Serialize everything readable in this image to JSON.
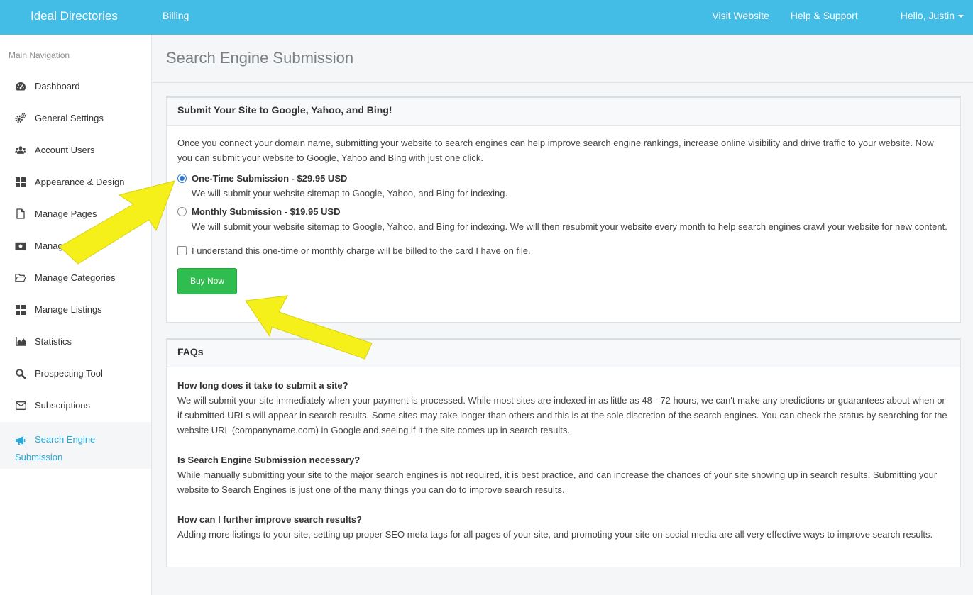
{
  "topbar": {
    "brand": "Ideal Directories",
    "billing": "Billing",
    "visit_website": "Visit Website",
    "help_support": "Help & Support",
    "user_menu": "Hello, Justin"
  },
  "sidebar": {
    "heading": "Main Navigation",
    "items": [
      {
        "label": "Dashboard",
        "icon": "dashboard-icon"
      },
      {
        "label": "General Settings",
        "icon": "gears-icon"
      },
      {
        "label": "Account Users",
        "icon": "users-icon"
      },
      {
        "label": "Appearance & Design",
        "icon": "grid-icon"
      },
      {
        "label": "Manage Pages",
        "icon": "file-icon"
      },
      {
        "label": "Manage",
        "icon": "money-icon"
      },
      {
        "label": "Manage Categories",
        "icon": "folder-open-icon"
      },
      {
        "label": "Manage Listings",
        "icon": "grid-icon"
      },
      {
        "label": "Statistics",
        "icon": "area-chart-icon"
      },
      {
        "label": "Prospecting Tool",
        "icon": "search-icon"
      },
      {
        "label": "Subscriptions",
        "icon": "envelope-icon"
      },
      {
        "label": "Search Engine Submission",
        "label_line1": "Search Engine",
        "label_line2": "Submission",
        "icon": "megaphone-icon",
        "active": true
      }
    ]
  },
  "main": {
    "page_title": "Search Engine Submission",
    "submit_panel": {
      "title": "Submit Your Site to Google, Yahoo, and Bing!",
      "intro": "Once you connect your domain name, submitting your website to search engines can help improve search engine rankings, increase online visibility and drive traffic to your website. Now you can submit your website to Google, Yahoo and Bing with just one click.",
      "option1_title": "One-Time Submission - $29.95 USD",
      "option1_desc": "We will submit your website sitemap to Google, Yahoo, and Bing for indexing.",
      "option2_title": "Monthly Submission - $19.95 USD",
      "option2_desc": "We will submit your website sitemap to Google, Yahoo, and Bing for indexing. We will then resubmit your website every month to help search engines crawl your website for new content.",
      "agree_label": "I understand this one-time or monthly charge will be billed to the card I have on file.",
      "buy_label": "Buy Now"
    },
    "faq_panel": {
      "title": "FAQs",
      "items": [
        {
          "q": "How long does it take to submit a site?",
          "a": "We will submit your site immediately when your payment is processed. While most sites are indexed in as little as 48 - 72 hours, we can't make any predictions or guarantees about when or if submitted URLs will appear in search results. Some sites may take longer than others and this is at the sole discretion of the search engines. You can check the status by searching for the website URL (companyname.com) in Google and seeing if it the site comes up in search results."
        },
        {
          "q": "Is Search Engine Submission necessary?",
          "a": "While manually submitting your site to the major search engines is not required, it is best practice, and can increase the chances of your site showing up in search results. Submitting your website to Search Engines is just one of the many things you can do to improve search results."
        },
        {
          "q": "How can I further improve search results?",
          "a": "Adding more listings to your site, setting up proper SEO meta tags for all pages of your site, and promoting your site on social media are all very effective ways to improve search results."
        }
      ]
    }
  },
  "colors": {
    "topbar": "#43bde6",
    "active_nav": "#29a8d8",
    "buy_button": "#2fbd4f",
    "annotation_arrow": "#f5ef1a"
  }
}
